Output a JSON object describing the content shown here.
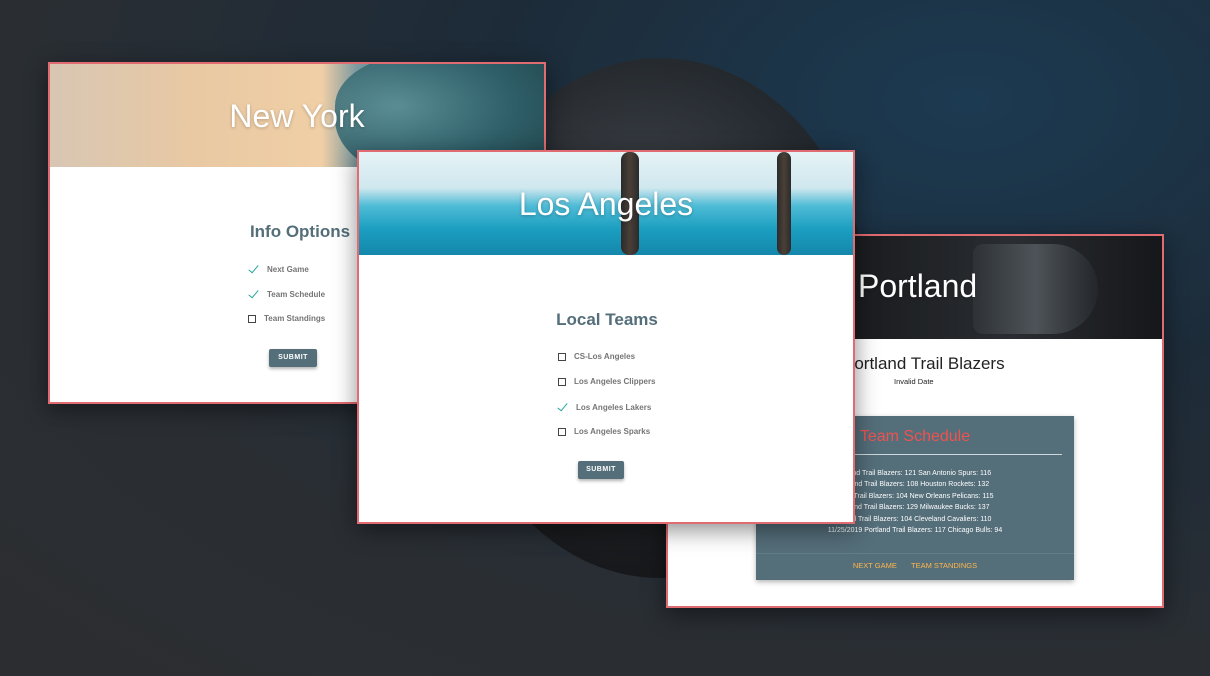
{
  "new_york": {
    "city": "New York",
    "section_title": "Info Options",
    "options": [
      {
        "label": "Next Game",
        "checked": true
      },
      {
        "label": "Team Schedule",
        "checked": true
      },
      {
        "label": "Team Standings",
        "checked": false
      }
    ],
    "submit_label": "SUBMIT"
  },
  "los_angeles": {
    "city": "Los Angeles",
    "section_title": "Local Teams",
    "options": [
      {
        "label": "CS-Los Angeles",
        "checked": false
      },
      {
        "label": "Los Angeles Clippers",
        "checked": false
      },
      {
        "label": "Los Angeles Lakers",
        "checked": true
      },
      {
        "label": "Los Angeles Sparks",
        "checked": false
      }
    ],
    "submit_label": "SUBMIT"
  },
  "portland": {
    "city": "Portland",
    "team_name": "Portland Trail Blazers",
    "date": "Invalid Date",
    "schedule_title": "Team Schedule",
    "schedule": [
      "ortland Trail Blazers: 121 San Antonio Spurs: 116",
      "ortland Trail Blazers: 108 Houston Rockets: 132",
      "tland Trail Blazers: 104 New Orleans Pelicans: 115",
      "ortland Trail Blazers: 129 Milwaukee Bucks: 137",
      "rtland Trail Blazers: 104 Cleveland Cavaliers: 110",
      "11/25/2019 Portland Trail Blazers: 117 Chicago Bulls: 94"
    ],
    "links": {
      "next_game": "NEXT GAME",
      "team_standings": "TEAM STANDINGS"
    }
  },
  "colors": {
    "accent_border": "#e06b70",
    "slate": "#546e7a",
    "link": "#ffb74d",
    "schedule_title": "#ef5350",
    "check": "#26a69a"
  }
}
